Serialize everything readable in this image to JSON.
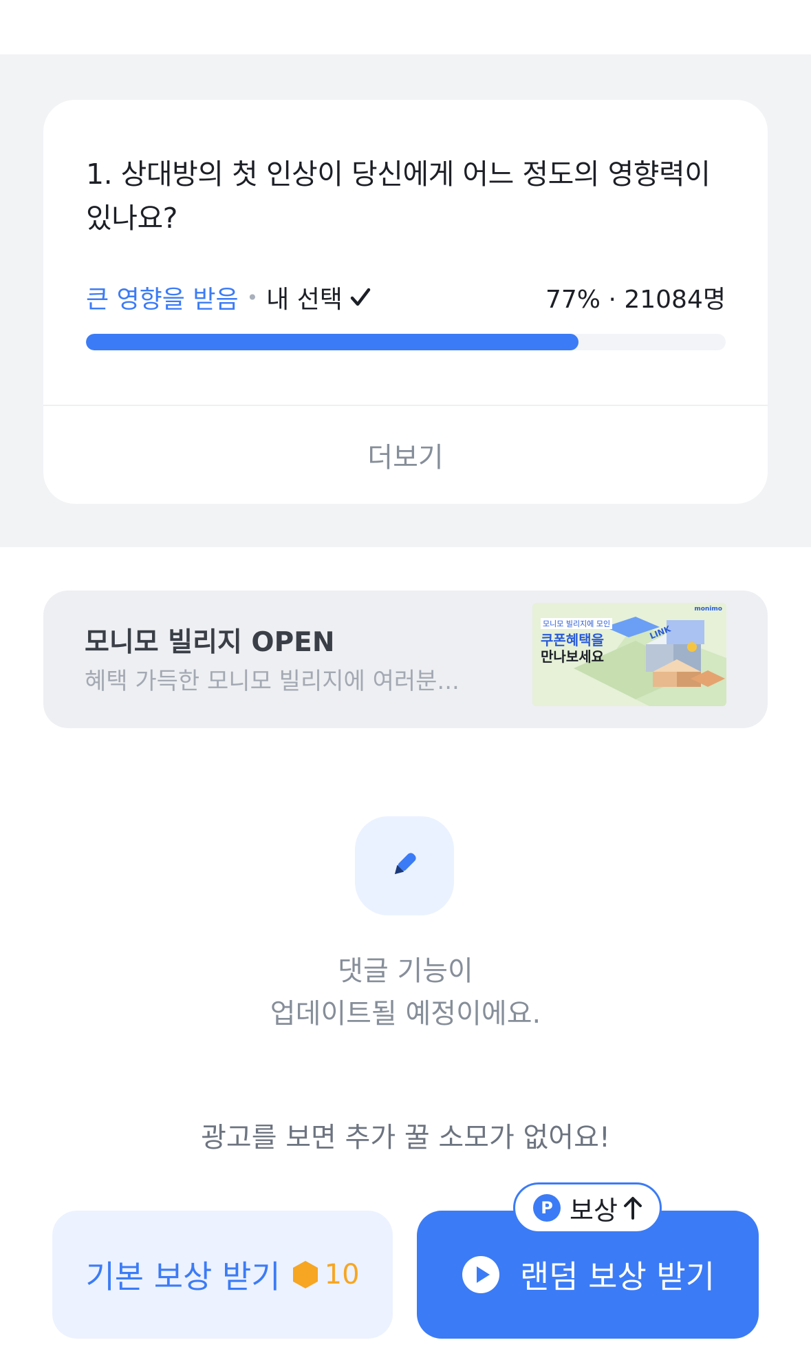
{
  "poll": {
    "question": "1. 상대방의 첫 인상이 당신에게 어느 정도의 영향력이 있나요?",
    "option_label": "큰 영향을 받음",
    "separator": "•",
    "my_choice_label": "내 선택",
    "stat": "77% · 21084명",
    "percent": 77,
    "more_label": "더보기"
  },
  "banner": {
    "title": "모니모 빌리지 OPEN",
    "subtitle": "혜택 가득한 모니모 빌리지에 여러분...",
    "thumb": {
      "brand": "monimo",
      "line1": "모니모 빌리지에 모인",
      "line2": "쿠폰혜택을",
      "line3": "만나보세요",
      "sign": "LINK"
    }
  },
  "comments": {
    "line1": "댓글 기능이",
    "line2": "업데이트될 예정이에요."
  },
  "ad_note": "광고를 보면 추가 꿀 소모가 없어요!",
  "buttons": {
    "basic_label": "기본 보상 받기",
    "basic_cost": "10",
    "random_label": "랜덤 보상 받기",
    "reward_badge": "보상"
  },
  "colors": {
    "accent": "#3b7bf6",
    "coin": "#f6a623",
    "gray_band": "#f2f3f5"
  }
}
